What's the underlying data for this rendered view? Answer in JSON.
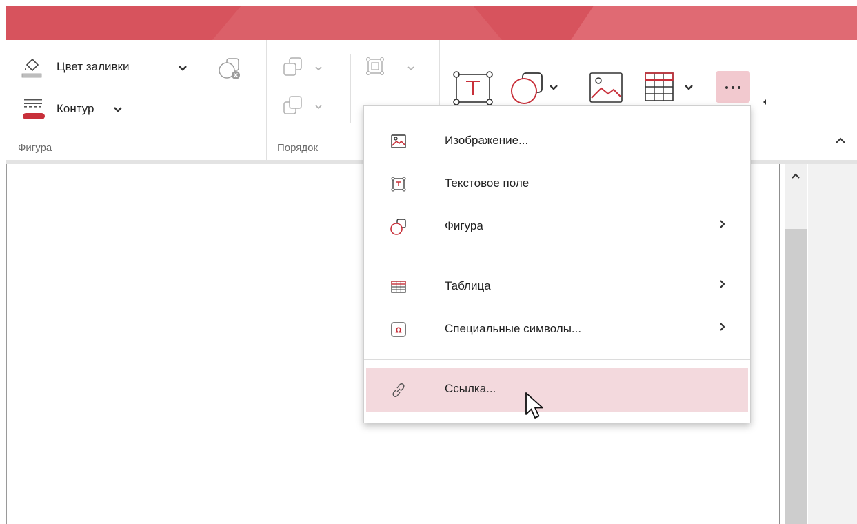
{
  "ribbon": {
    "fill_color_label": "Цвет заливки",
    "outline_label": "Контур",
    "group_shape_label": "Фигура",
    "group_order_label": "Порядок"
  },
  "menu": {
    "items": [
      {
        "label": "Изображение...",
        "icon": "image-icon",
        "submenu": false
      },
      {
        "label": "Текстовое поле",
        "icon": "text-box-icon",
        "submenu": false
      },
      {
        "label": "Фигура",
        "icon": "shape-icon",
        "submenu": true
      },
      {
        "label": "Таблица",
        "icon": "table-icon",
        "submenu": true
      },
      {
        "label": "Специальные символы...",
        "icon": "special-symbols-icon",
        "submenu": true
      },
      {
        "label": "Ссылка...",
        "icon": "link-icon",
        "submenu": false,
        "highlighted": true
      }
    ]
  },
  "colors": {
    "accent": "#d7535d",
    "accent_dark": "#c8303a",
    "highlight": "#f3d9dd",
    "more_button_bg": "#f2c9cf"
  }
}
